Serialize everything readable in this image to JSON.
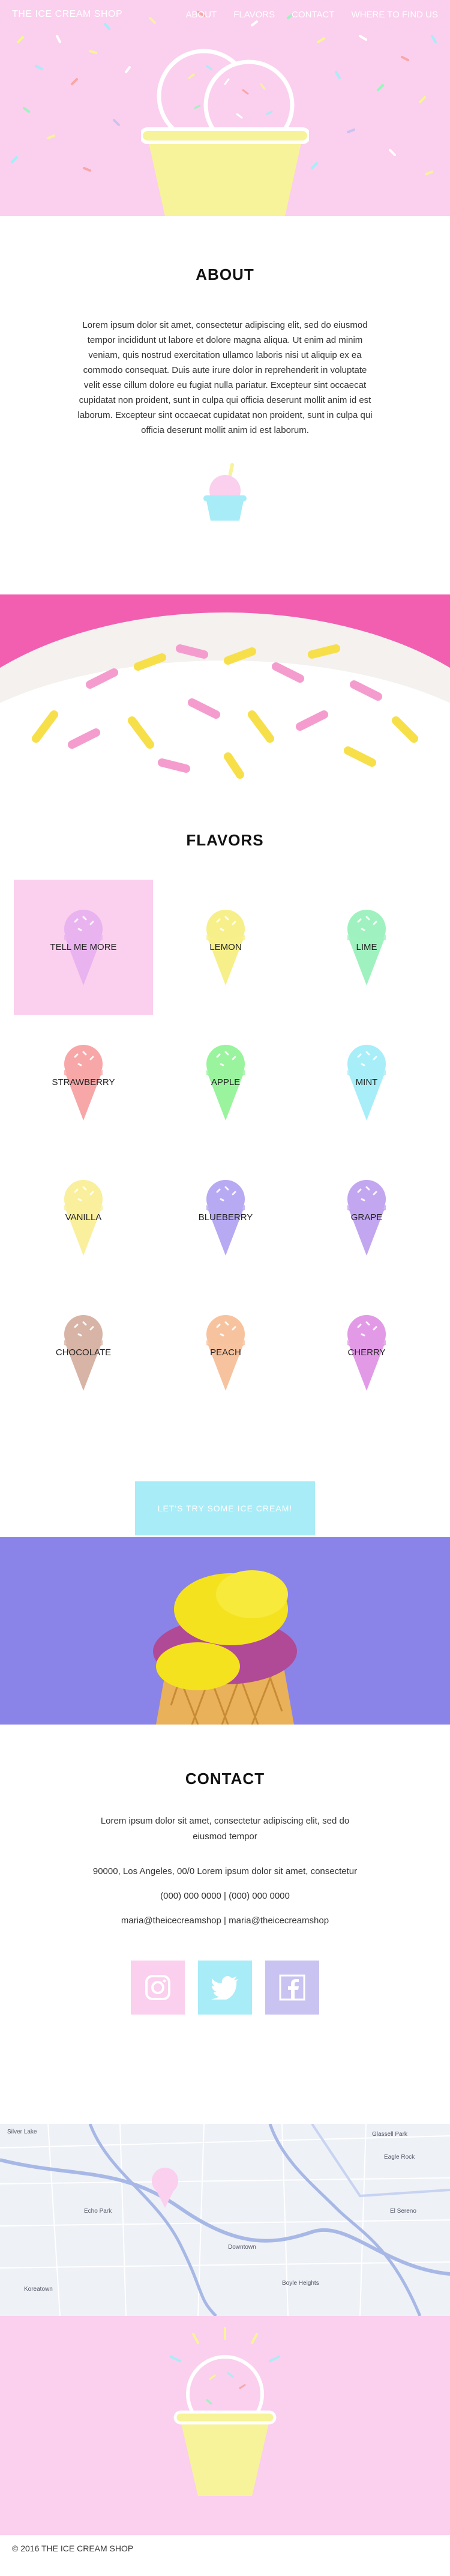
{
  "nav": {
    "brand": "THE ICE CREAM SHOP",
    "links": [
      "ABOUT",
      "FLAVORS",
      "CONTACT",
      "WHERE TO FIND US"
    ]
  },
  "about": {
    "title": "ABOUT",
    "text": "Lorem ipsum dolor sit amet, consectetur adipiscing elit, sed do eiusmod tempor incididunt ut labore et dolore magna aliqua. Ut enim ad minim veniam, quis nostrud exercitation ullamco laboris nisi ut aliquip ex ea commodo consequat. Duis aute irure dolor in reprehenderit in voluptate velit esse cillum dolore eu fugiat nulla pariatur. Excepteur sint occaecat cupidatat non proident, sunt in culpa qui officia deserunt mollit anim id est laborum. Excepteur sint occaecat cupidatat non proident, sunt in culpa qui officia deserunt mollit anim id est laborum."
  },
  "flavors": {
    "title": "FLAVORS",
    "items": [
      {
        "label": "TELL ME MORE",
        "color": "#e9b3ef"
      },
      {
        "label": "LEMON",
        "color": "#f7f08a"
      },
      {
        "label": "LIME",
        "color": "#9ff2bf"
      },
      {
        "label": "STRAWBERRY",
        "color": "#f7a7a7"
      },
      {
        "label": "APPLE",
        "color": "#9af39d"
      },
      {
        "label": "MINT",
        "color": "#a7eef8"
      },
      {
        "label": "VANILLA",
        "color": "#f9ef9d"
      },
      {
        "label": "BLUEBERRY",
        "color": "#b8a9f3"
      },
      {
        "label": "GRAPE",
        "color": "#c2a6ef"
      },
      {
        "label": "CHOCOLATE",
        "color": "#d8b4a6"
      },
      {
        "label": "PEACH",
        "color": "#f7c39f"
      },
      {
        "label": "CHERRY",
        "color": "#e29ae7"
      }
    ],
    "cta": "LET'S TRY SOME ICE CREAM!"
  },
  "contact": {
    "title": "CONTACT",
    "intro": "Lorem ipsum dolor sit amet, consectetur adipiscing elit, sed do eiusmod tempor",
    "address": "90000, Los Angeles, 00/0 Lorem ipsum dolor sit amet, consectetur",
    "phones": "(000) 000 0000  |  (000) 000 0000",
    "emails": "maria@theicecreamshop  |  maria@theicecreamshop"
  },
  "map": {
    "labels": [
      "Silver Lake",
      "Glassell Park",
      "Eagle Rock",
      "Echo Park",
      "El Sereno",
      "Downtown",
      "Boyle Heights",
      "Koreatown"
    ]
  },
  "footer": {
    "copyright": "© 2016 THE ICE CREAM SHOP"
  },
  "colors": {
    "pink": "#fbcfee",
    "cyan": "#a8ecf7",
    "lavender": "#c9c3f2",
    "yellow": "#f7f39a"
  },
  "icons": [
    "instagram-icon",
    "twitter-icon",
    "facebook-icon"
  ]
}
